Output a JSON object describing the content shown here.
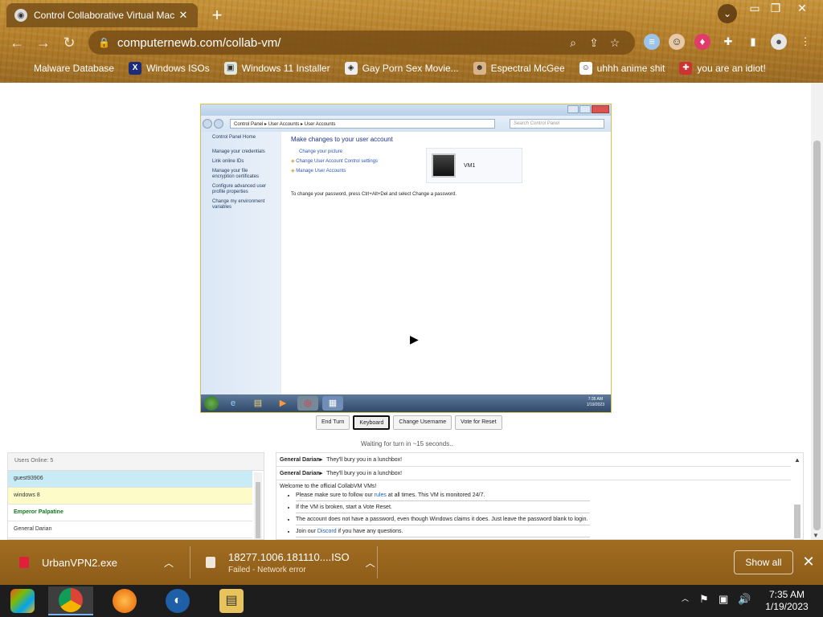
{
  "browser": {
    "tab_title": "Control Collaborative Virtual Mac",
    "url": "computernewb.com/collab-vm/",
    "bookmarks": [
      {
        "label": "Malware Database"
      },
      {
        "label": "Windows ISOs"
      },
      {
        "label": "Windows 11 Installer"
      },
      {
        "label": "Gay Porn Sex Movie..."
      },
      {
        "label": "Espectral McGee"
      },
      {
        "label": "uhhh anime shit"
      },
      {
        "label": "you are an idiot!"
      }
    ],
    "theme_color": "#b57f2a"
  },
  "vm": {
    "breadcrumb": "Control Panel  ▸  User Accounts  ▸  User Accounts",
    "search_placeholder": "Search Control Panel",
    "left_links": {
      "home": "Control Panel Home",
      "credentials": "Manage your credentials",
      "link_ids": "Link online IDs",
      "encryption": "Manage your file encryption certificates",
      "profile": "Configure advanced user profile properties",
      "env": "Change my environment variables"
    },
    "heading": "Make changes to your user account",
    "links": {
      "picture": "Change your picture",
      "uac": "Change User Account Control settings",
      "manage": "Manage User Accounts"
    },
    "user_name": "VM1",
    "note": "To change your password, press Ctrl+Alt+Del and select Change a password.",
    "clock_time": "7:35 AM",
    "clock_date": "1/19/2023"
  },
  "controls": {
    "end_turn": "End Turn",
    "keyboard": "Keyboard",
    "change_username": "Change Username",
    "vote_reset": "Vote for Reset",
    "turn_status": "Waiting for turn in ~15 seconds.."
  },
  "users": {
    "header": "Users Online: 5",
    "list": [
      "guest93906",
      "windows 8",
      "Emperor Palpatine",
      "General Darian"
    ]
  },
  "chat": {
    "messages": [
      {
        "user": "General Darian▸",
        "text": "They'll bury you in a lunchbox!"
      },
      {
        "user": "General Darian▸",
        "text": "They'll bury you in a lunchbox!"
      }
    ],
    "welcome": "Welcome to the official CollabVM VMs!",
    "rules": {
      "pre": "Please make sure to follow our ",
      "link": "rules",
      "post": " at all times. This VM is monitored 24/7."
    },
    "broken": "If the VM is broken, start a Vote Reset.",
    "password": "The account does not have a password, even though Windows claims it does. Just leave the password blank to login.",
    "discord": {
      "pre": "Join our ",
      "link": "Discord",
      "post": " if you have any questions."
    }
  },
  "downloads": [
    {
      "name": "UrbanVPN2.exe",
      "status": ""
    },
    {
      "name": "18277.1006.181110....ISO",
      "status": "Failed - Network error"
    }
  ],
  "show_all": "Show all",
  "system": {
    "time": "7:35 AM",
    "date": "1/19/2023"
  }
}
